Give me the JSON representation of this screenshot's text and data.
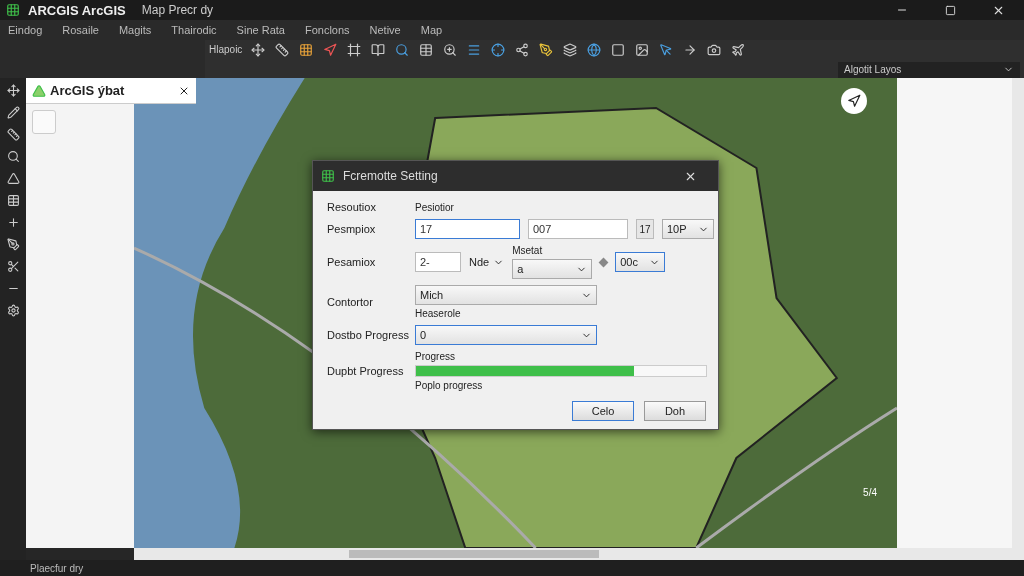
{
  "window": {
    "title": "ARCGIS ArcGIS",
    "subtitle": "Map Precr dy"
  },
  "menu": [
    "Eindog",
    "Rosaile",
    "Magits",
    "Thairodic",
    "Sine Rata",
    "Fonclons",
    "Netive",
    "Map"
  ],
  "toolbar": {
    "label": "Hlapoic"
  },
  "layer_select": {
    "value": "Algotit Layos"
  },
  "left_panel": {
    "tab": "ArcGIS ýbat"
  },
  "dialog": {
    "title": "Fcremotte Setting",
    "rows": [
      {
        "kind": "header",
        "label": "Resoutiox",
        "text": "Pesiotior"
      },
      {
        "kind": "inputs",
        "label": "Pesmpiox",
        "first": {
          "value": "17",
          "focused": true
        },
        "second": {
          "value": "007",
          "focused": false
        },
        "small": "17",
        "select": {
          "value": "10P",
          "focused": false
        }
      },
      {
        "kind": "mixed",
        "label": "Pesamiox",
        "input": {
          "value": "2-",
          "focused": false
        },
        "dropdown": "Nde",
        "field_label": "Msetat",
        "field_value": "a",
        "select": {
          "value": "00c",
          "focused": true
        }
      },
      {
        "kind": "select",
        "label": "Contortor",
        "select": {
          "value": "Mich",
          "focused": false
        },
        "note": "Heaserole"
      },
      {
        "kind": "select",
        "label": "Dostbo Progress",
        "select": {
          "value": "0",
          "focused": true
        }
      },
      {
        "kind": "progress",
        "label": "Dupbt Progress",
        "caption": "Progress",
        "level": 0.75,
        "footer": "Poplo progress"
      }
    ],
    "buttons": [
      {
        "label": "Celo",
        "default": true
      },
      {
        "label": "Doh",
        "default": false
      }
    ]
  },
  "map": {
    "scale": "5/4"
  },
  "status_bar": {
    "text": "Plaecfur dry"
  }
}
